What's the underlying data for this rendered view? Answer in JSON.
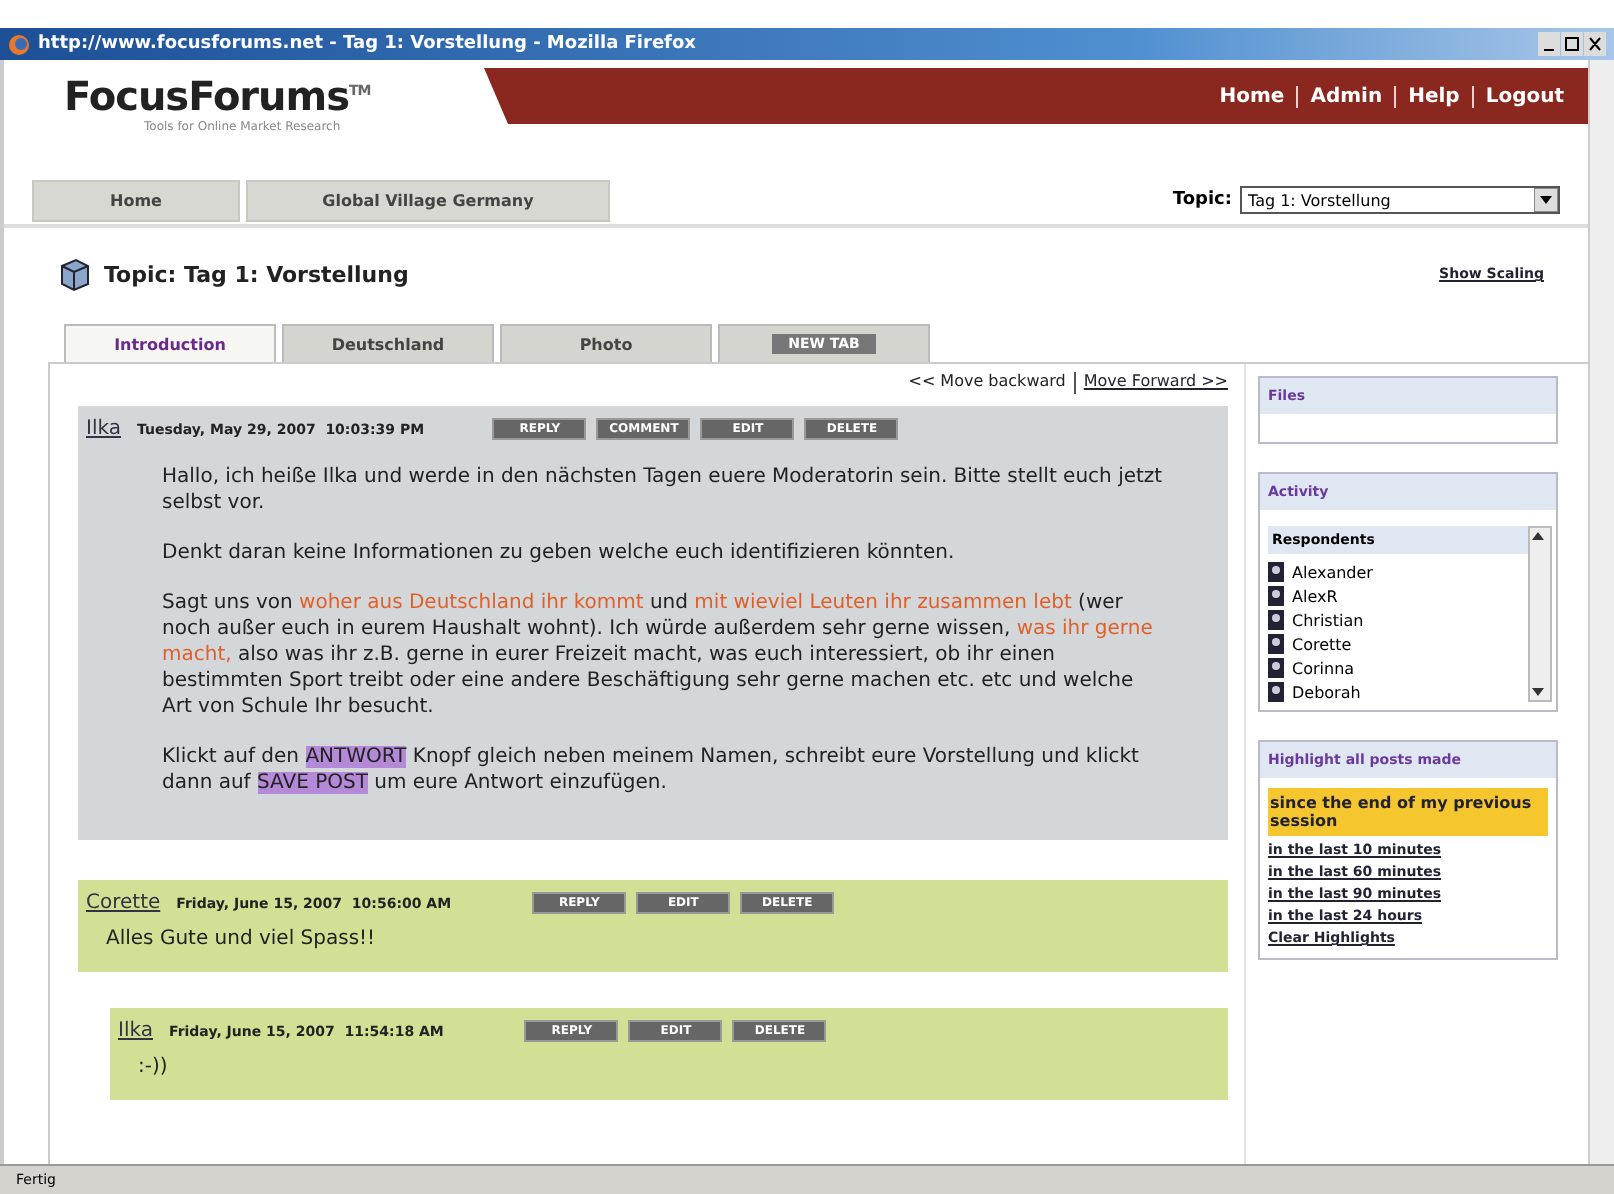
{
  "window": {
    "title": "http://www.focusforums.net - Tag 1: Vorstellung - Mozilla Firefox"
  },
  "header": {
    "logo": "FocusForums",
    "logo_mark": "TM",
    "tagline": "Tools for Online Market Research",
    "nav": [
      "Home",
      "Admin",
      "Help",
      "Logout"
    ]
  },
  "nav_tabs": [
    {
      "label": "Home"
    },
    {
      "label": "Global Village Germany"
    }
  ],
  "topic_select": {
    "label": "Topic:",
    "value": "Tag 1: Vorstellung"
  },
  "topic_title": "Topic: Tag 1: Vorstellung",
  "show_scaling": "Show Scaling",
  "tabs": [
    {
      "label": "Introduction",
      "selected": true
    },
    {
      "label": "Deutschland",
      "selected": false
    },
    {
      "label": "Photo",
      "selected": false
    },
    {
      "label": "NEW TAB",
      "selected": false
    }
  ],
  "pager": {
    "backward": "<< Move backward",
    "forward": "Move Forward >>"
  },
  "posts": [
    {
      "author": "Ilka",
      "date": "Tuesday, May 29, 2007  10:03:39 PM",
      "buttons": [
        "REPLY",
        "COMMENT",
        "EDIT",
        "DELETE"
      ],
      "paragraphs": [
        [
          {
            "kind": "plain",
            "text": "Hallo, ich heiße Ilka und werde in den nächsten Tagen euere Moderatorin sein. Bitte stellt euch jetzt selbst vor."
          }
        ],
        [
          {
            "kind": "plain",
            "text": "Denkt daran keine Informationen zu geben welche euch identifizieren könnten."
          }
        ],
        [
          {
            "kind": "plain",
            "text": "Sagt uns von "
          },
          {
            "kind": "accent",
            "text": "woher aus Deutschland ihr kommt"
          },
          {
            "kind": "plain",
            "text": " und "
          },
          {
            "kind": "accent",
            "text": "mit wieviel Leuten ihr zusammen lebt"
          },
          {
            "kind": "plain",
            "text": " (wer noch außer euch in eurem Haushalt wohnt).  Ich würde außerdem sehr gerne wissen, "
          },
          {
            "kind": "accent",
            "text": "was ihr gerne macht,"
          },
          {
            "kind": "plain",
            "text": " also was ihr z.B. gerne in eurer Freizeit macht, was euch interessiert, ob ihr einen bestimmten Sport treibt oder eine andere Beschäftigung sehr gerne machen etc. etc und welche Art von Schule Ihr besucht."
          }
        ],
        [
          {
            "kind": "plain",
            "text": "Klickt auf den "
          },
          {
            "kind": "mark",
            "text": "ANTWORT"
          },
          {
            "kind": "plain",
            "text": " Knopf gleich neben meinem Namen, schreibt eure Vorstellung und klickt dann auf "
          },
          {
            "kind": "mark",
            "text": "SAVE POST"
          },
          {
            "kind": "plain",
            "text": " um eure Antwort einzufügen."
          }
        ]
      ],
      "children": [
        {
          "author": "Corette",
          "date": "Friday, June 15, 2007  10:56:00 AM",
          "buttons": [
            "REPLY",
            "EDIT",
            "DELETE"
          ],
          "paragraphs": [
            [
              {
                "kind": "plain",
                "text": "Alles Gute und viel Spass!!"
              }
            ]
          ],
          "children": [
            {
              "author": "Ilka",
              "date": "Friday, June 15, 2007  11:54:18 AM",
              "buttons": [
                "REPLY",
                "EDIT",
                "DELETE"
              ],
              "paragraphs": [
                [
                  {
                    "kind": "plain",
                    "text": ":-))"
                  }
                ]
              ]
            }
          ]
        }
      ]
    }
  ],
  "sidebar": {
    "files": {
      "title": "Files"
    },
    "activity": {
      "title": "Activity",
      "heading": "Respondents",
      "respondents": [
        "Alexander",
        "AlexR",
        "Christian",
        "Corette",
        "Corinna",
        "Deborah"
      ]
    },
    "highlight": {
      "title": "Highlight all posts made",
      "options": [
        {
          "label": "since the end of my previous session",
          "selected": true
        },
        {
          "label": "in the last 10 minutes",
          "selected": false
        },
        {
          "label": "in the last 60 minutes",
          "selected": false
        },
        {
          "label": "in the last 90 minutes",
          "selected": false
        },
        {
          "label": "in the last 24 hours",
          "selected": false
        }
      ],
      "clear": "Clear Highlights"
    }
  },
  "status_bar": {
    "text": "Fertig"
  }
}
